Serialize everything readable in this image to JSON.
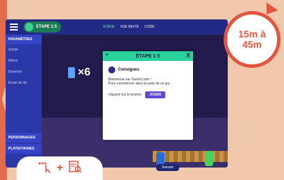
{
  "screen": {
    "etape_label": "ÉTAPE",
    "etape_value": "1:5",
    "nav": [
      "SCÈNE",
      "VUE MIXTE",
      "CODE"
    ],
    "sidebar": {
      "header": "PARAMÈTRES",
      "items": [
        "Scène",
        "Héros",
        "Ennemis",
        "Écran de fin"
      ],
      "footer": [
        "PERSONNAGES",
        "PLATEFORMES"
      ]
    },
    "lives": "×6"
  },
  "modal": {
    "title": "ÉTAPE  1:5",
    "close": "X",
    "move_icon": "+",
    "consignes_title": "Consignes",
    "text1": "Bienvenue sur GameCode !",
    "text2": "Pour commencer lisez la suite de ce jeu",
    "text3": "cliquant sur le bouton",
    "button": "JOUER"
  },
  "next_button": "Suivant",
  "timer": {
    "line1": "15m à",
    "line2": "45m"
  },
  "footer_tag": {
    "plus": "+"
  }
}
